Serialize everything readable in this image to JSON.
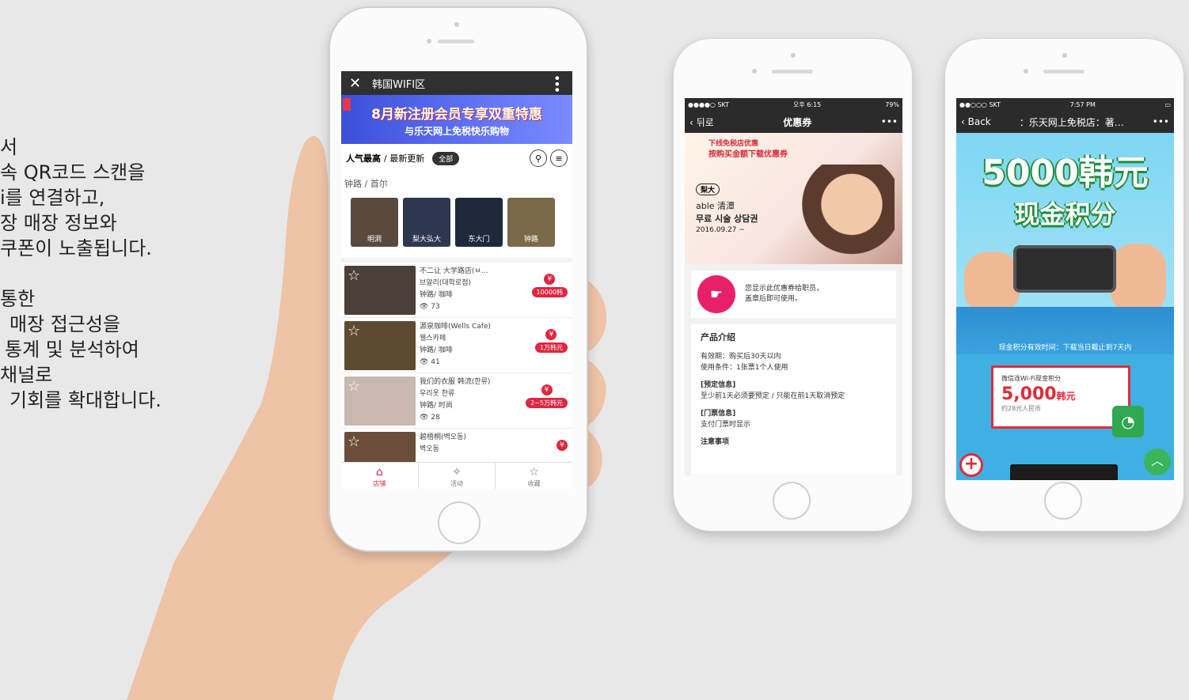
{
  "intro": {
    "lines": [
      "서",
      "속 QR코드 스캔을",
      "i를 연결하고,",
      "장 매장 정보와",
      "쿠폰이 노출됩니다.",
      "",
      "통한",
      "매장 접근성을",
      "통계 및 분석하여",
      "채널로",
      "기회를 확대합니다."
    ]
  },
  "main_phone": {
    "window_title": "韩国WIFI区",
    "promo_line1": "8月新注册会员专享双重特惠",
    "promo_line2": "与乐天网上免税快乐购物",
    "filter_popular": "人气最高",
    "filter_latest": "/ 最新更新",
    "filter_all": "全部",
    "location": "钟路 / 首尔",
    "thumbs": [
      {
        "label": "明洞",
        "color": "#5a4a3e"
      },
      {
        "label": "梨大弘大",
        "color": "#2d3850"
      },
      {
        "label": "东大门",
        "color": "#1e2a3c"
      },
      {
        "label": "钟路",
        "color": "#7a6a4a"
      }
    ],
    "items": [
      {
        "line1": "不二让 大学路店(ㅂ…",
        "line2": "브알리(대학로점)",
        "line3": "钟路/ 咖啡",
        "views": "73",
        "price": "10000韩",
        "color": "#4a4038"
      },
      {
        "line1": "源泉咖啡(Wells Cafe)",
        "line2": "웰스카페",
        "line3": "钟路/ 咖啡",
        "views": "41",
        "price": "1万韩元",
        "color": "#5e4a30"
      },
      {
        "line1": "我们的衣服 韩流(한류)",
        "line2": "우리옷 한류",
        "line3": "钟路/ 时尚",
        "views": "28",
        "price": "2~5万韩元",
        "color": "#c9b8b0"
      },
      {
        "line1": "碧梧桐(벽오동)",
        "line2": "벽오동",
        "line3": "",
        "views": "",
        "price": "",
        "color": "#6a4e3a"
      }
    ],
    "nav": [
      {
        "label": "店铺",
        "icon": "home-icon"
      },
      {
        "label": "活动",
        "icon": "gift-icon"
      },
      {
        "label": "收藏",
        "icon": "star-icon"
      }
    ]
  },
  "mid_phone": {
    "status_carrier": "●●●●○ SKT",
    "status_time": "오후 6:15",
    "status_battery": "79%",
    "back_label": "뒤로",
    "title": "优惠券",
    "more": "•••",
    "banner_t1": "下线免税店优惠",
    "banner_t2": "按购买金额下载优惠券",
    "badge": "梨大",
    "brand": "able 清潭",
    "offer": "무료 시술 상담권",
    "date": "2016.09.27 ~",
    "info_line1": "您显示此优惠券给职员，",
    "info_line2": "盖章后即可使用。",
    "detail_title": "产品介绍",
    "detail_l1": "有效期：购买后30天以内",
    "detail_l2": "使用条件：1张票1个人使用",
    "detail_h2": "[预定信息]",
    "detail_l3": "至少前1天必须要预定 / 只能在前1天取消预定",
    "detail_h3": "[门票信息]",
    "detail_l4": "支付门票时显示",
    "detail_h4": "注意事项"
  },
  "right_phone": {
    "status_carrier": "●●○○○ SKT",
    "status_time": "7:57 PM",
    "back_label": "Back",
    "title": "：乐天网上免税店：著…",
    "more": "•••",
    "hero_big": "5000韩元",
    "hero_sub": "现金积分",
    "validity": "现金积分有效时间：下载当日截止到7天内",
    "card_label": "微信连Wi-Fi现金积分",
    "card_amount": "5,000",
    "card_unit": "韩元",
    "card_rmb": "约28元人民币"
  }
}
